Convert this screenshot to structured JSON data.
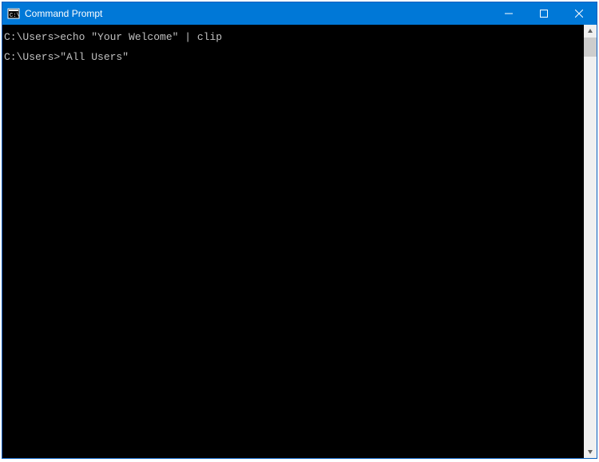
{
  "window": {
    "title": "Command Prompt"
  },
  "terminal": {
    "lines": [
      {
        "prompt": "C:\\Users>",
        "command": "echo \"Your Welcome\" | clip"
      },
      {
        "prompt": "",
        "command": ""
      },
      {
        "prompt": "C:\\Users>",
        "command": "\"All Users\""
      }
    ]
  }
}
